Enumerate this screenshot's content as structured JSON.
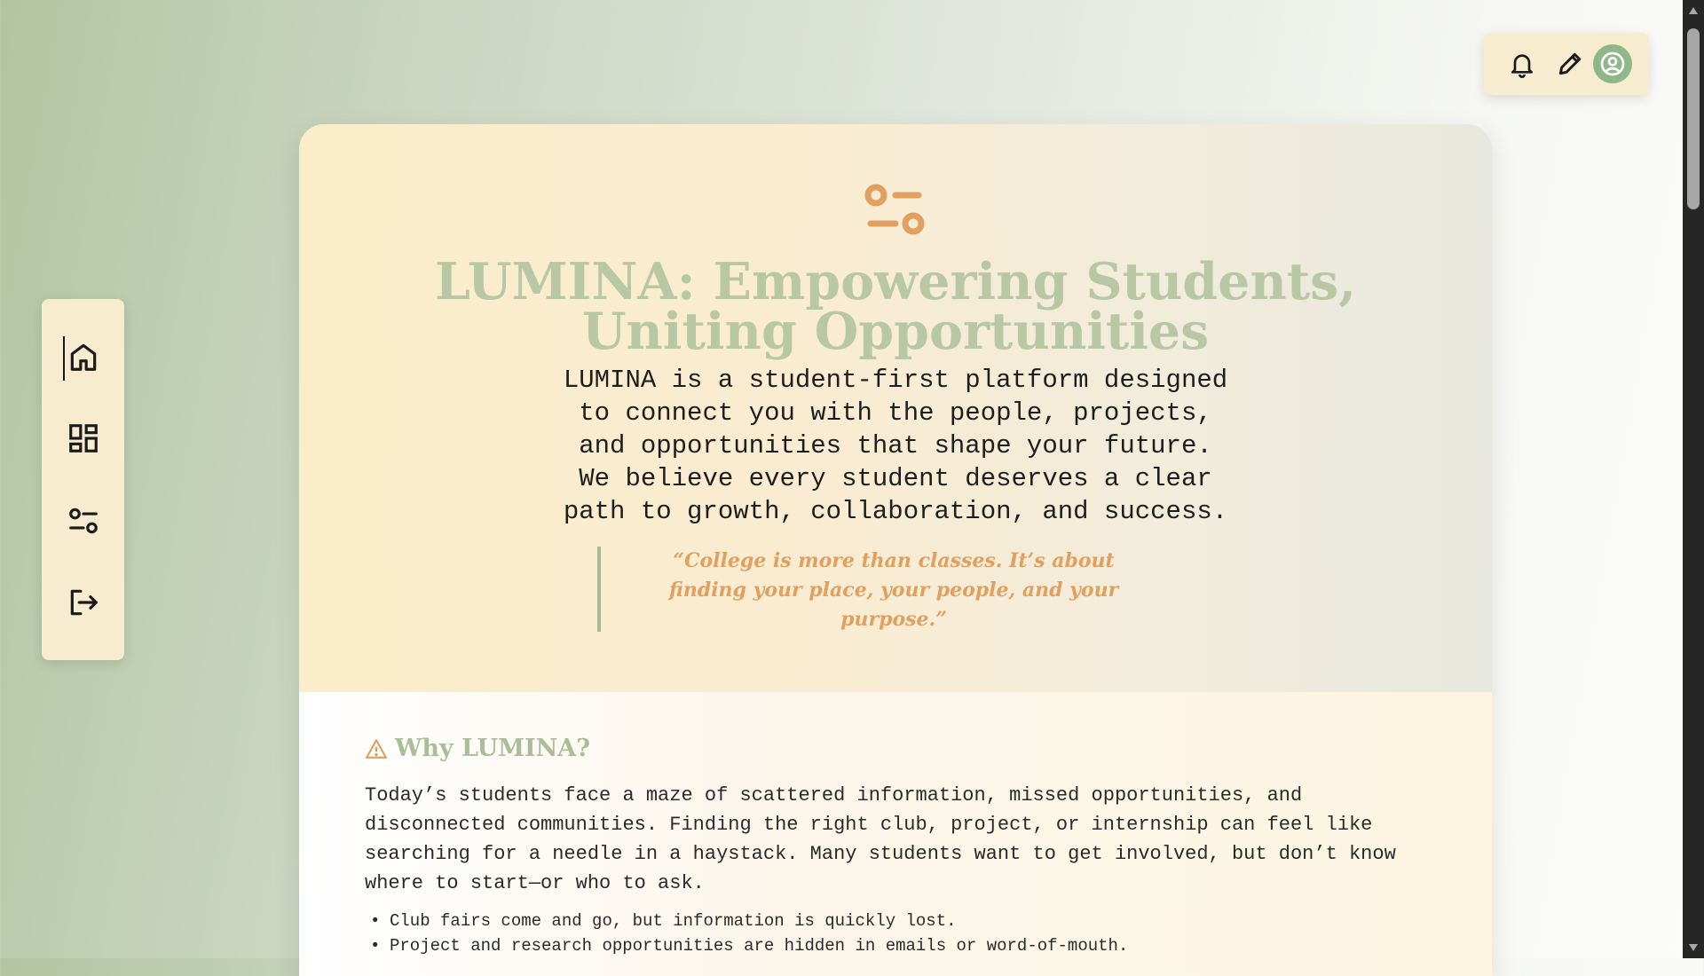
{
  "sidebar": {
    "items": [
      {
        "icon": "home-icon",
        "active": true
      },
      {
        "icon": "dashboard-icon",
        "active": false
      },
      {
        "icon": "sliders-icon",
        "active": false
      },
      {
        "icon": "logout-icon",
        "active": false
      }
    ]
  },
  "topbar": {
    "icons": [
      "bell-icon",
      "pencil-icon",
      "user-circle-icon"
    ]
  },
  "hero": {
    "title_line1": "LUMINA: Empowering Students,",
    "title_line2": "Uniting Opportunities",
    "desc_line1": "LUMINA is a student-first platform designed",
    "desc_line2": "to connect you with the people, projects,",
    "desc_line3": "and opportunities that shape your future.",
    "desc_line4": "We believe every student deserves a clear",
    "desc_line5": "path to growth, collaboration, and success.",
    "quote_line1": "“College is more than classes. It’s about",
    "quote_line2": "finding your place, your people, and your",
    "quote_line3": "purpose.”"
  },
  "why": {
    "heading": "Why LUMINA?",
    "para_line1": "Today’s students face a maze of scattered information, missed opportunities, and",
    "para_line2": "disconnected communities. Finding the right club, project, or internship can feel like",
    "para_line3": "searching for a needle in a haystack. Many students want to get involved, but don’t know",
    "para_line4": "where to start—or who to ask.",
    "bullets": [
      "Club fairs come and go, but information is quickly lost.",
      "Project and research opportunities are hidden in emails or word-of-mouth."
    ]
  },
  "colors": {
    "accent_orange": "#e0a060",
    "accent_green": "#b8c8a5",
    "panel_bg": "#f8ecd0",
    "avatar_bg": "#8fb78a"
  }
}
